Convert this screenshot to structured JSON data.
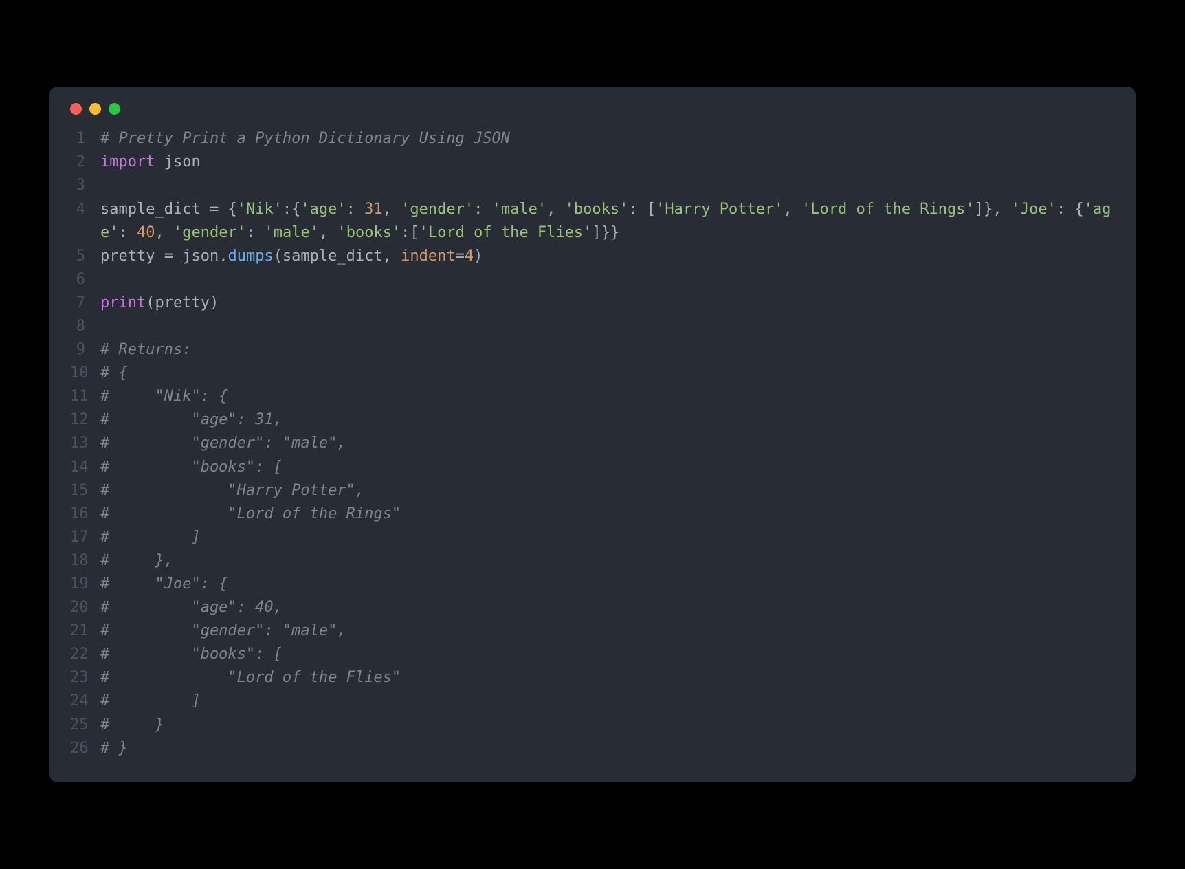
{
  "window": {
    "traffic_lights": [
      "red",
      "yellow",
      "green"
    ]
  },
  "code": {
    "lines": [
      {
        "num": "1",
        "tokens": [
          {
            "cls": "tok-comment",
            "text": "# Pretty Print a Python Dictionary Using JSON"
          }
        ]
      },
      {
        "num": "2",
        "tokens": [
          {
            "cls": "tok-keyword",
            "text": "import"
          },
          {
            "cls": "tok-op",
            "text": " "
          },
          {
            "cls": "tok-module",
            "text": "json"
          }
        ]
      },
      {
        "num": "3",
        "tokens": []
      },
      {
        "num": "4",
        "tokens": [
          {
            "cls": "tok-module",
            "text": "sample_dict "
          },
          {
            "cls": "tok-op",
            "text": "= {"
          },
          {
            "cls": "tok-string",
            "text": "'Nik'"
          },
          {
            "cls": "tok-op",
            "text": ":{"
          },
          {
            "cls": "tok-string",
            "text": "'age'"
          },
          {
            "cls": "tok-op",
            "text": ": "
          },
          {
            "cls": "tok-number",
            "text": "31"
          },
          {
            "cls": "tok-op",
            "text": ", "
          },
          {
            "cls": "tok-string",
            "text": "'gender'"
          },
          {
            "cls": "tok-op",
            "text": ": "
          },
          {
            "cls": "tok-string",
            "text": "'male'"
          },
          {
            "cls": "tok-op",
            "text": ", "
          },
          {
            "cls": "tok-string",
            "text": "'books'"
          },
          {
            "cls": "tok-op",
            "text": ": ["
          },
          {
            "cls": "tok-string",
            "text": "'Harry Potter'"
          },
          {
            "cls": "tok-op",
            "text": ", "
          },
          {
            "cls": "tok-string",
            "text": "'Lord of the Rings'"
          },
          {
            "cls": "tok-op",
            "text": "]}, "
          },
          {
            "cls": "tok-string",
            "text": "'Joe'"
          },
          {
            "cls": "tok-op",
            "text": ": {"
          },
          {
            "cls": "tok-string",
            "text": "'age'"
          },
          {
            "cls": "tok-op",
            "text": ": "
          },
          {
            "cls": "tok-number",
            "text": "40"
          },
          {
            "cls": "tok-op",
            "text": ", "
          },
          {
            "cls": "tok-string",
            "text": "'gender'"
          },
          {
            "cls": "tok-op",
            "text": ": "
          },
          {
            "cls": "tok-string",
            "text": "'male'"
          },
          {
            "cls": "tok-op",
            "text": ", "
          },
          {
            "cls": "tok-string",
            "text": "'books'"
          },
          {
            "cls": "tok-op",
            "text": ":["
          },
          {
            "cls": "tok-string",
            "text": "'Lord of the Flies'"
          },
          {
            "cls": "tok-op",
            "text": "]}}"
          }
        ]
      },
      {
        "num": "5",
        "tokens": [
          {
            "cls": "tok-module",
            "text": "pretty "
          },
          {
            "cls": "tok-op",
            "text": "= "
          },
          {
            "cls": "tok-attr",
            "text": "json."
          },
          {
            "cls": "tok-func",
            "text": "dumps"
          },
          {
            "cls": "tok-paren",
            "text": "(sample_dict, "
          },
          {
            "cls": "tok-param",
            "text": "indent"
          },
          {
            "cls": "tok-op",
            "text": "="
          },
          {
            "cls": "tok-number",
            "text": "4"
          },
          {
            "cls": "tok-paren",
            "text": ")"
          }
        ]
      },
      {
        "num": "6",
        "tokens": []
      },
      {
        "num": "7",
        "tokens": [
          {
            "cls": "tok-builtin",
            "text": "print"
          },
          {
            "cls": "tok-paren",
            "text": "(pretty)"
          }
        ]
      },
      {
        "num": "8",
        "tokens": []
      },
      {
        "num": "9",
        "tokens": [
          {
            "cls": "tok-comment",
            "text": "# Returns:"
          }
        ]
      },
      {
        "num": "10",
        "tokens": [
          {
            "cls": "tok-comment",
            "text": "# {"
          }
        ]
      },
      {
        "num": "11",
        "tokens": [
          {
            "cls": "tok-comment",
            "text": "#     \"Nik\": {"
          }
        ]
      },
      {
        "num": "12",
        "tokens": [
          {
            "cls": "tok-comment",
            "text": "#         \"age\": 31,"
          }
        ]
      },
      {
        "num": "13",
        "tokens": [
          {
            "cls": "tok-comment",
            "text": "#         \"gender\": \"male\","
          }
        ]
      },
      {
        "num": "14",
        "tokens": [
          {
            "cls": "tok-comment",
            "text": "#         \"books\": ["
          }
        ]
      },
      {
        "num": "15",
        "tokens": [
          {
            "cls": "tok-comment",
            "text": "#             \"Harry Potter\","
          }
        ]
      },
      {
        "num": "16",
        "tokens": [
          {
            "cls": "tok-comment",
            "text": "#             \"Lord of the Rings\""
          }
        ]
      },
      {
        "num": "17",
        "tokens": [
          {
            "cls": "tok-comment",
            "text": "#         ]"
          }
        ]
      },
      {
        "num": "18",
        "tokens": [
          {
            "cls": "tok-comment",
            "text": "#     },"
          }
        ]
      },
      {
        "num": "19",
        "tokens": [
          {
            "cls": "tok-comment",
            "text": "#     \"Joe\": {"
          }
        ]
      },
      {
        "num": "20",
        "tokens": [
          {
            "cls": "tok-comment",
            "text": "#         \"age\": 40,"
          }
        ]
      },
      {
        "num": "21",
        "tokens": [
          {
            "cls": "tok-comment",
            "text": "#         \"gender\": \"male\","
          }
        ]
      },
      {
        "num": "22",
        "tokens": [
          {
            "cls": "tok-comment",
            "text": "#         \"books\": ["
          }
        ]
      },
      {
        "num": "23",
        "tokens": [
          {
            "cls": "tok-comment",
            "text": "#             \"Lord of the Flies\""
          }
        ]
      },
      {
        "num": "24",
        "tokens": [
          {
            "cls": "tok-comment",
            "text": "#         ]"
          }
        ]
      },
      {
        "num": "25",
        "tokens": [
          {
            "cls": "tok-comment",
            "text": "#     }"
          }
        ]
      },
      {
        "num": "26",
        "tokens": [
          {
            "cls": "tok-comment",
            "text": "# }"
          }
        ]
      }
    ]
  }
}
